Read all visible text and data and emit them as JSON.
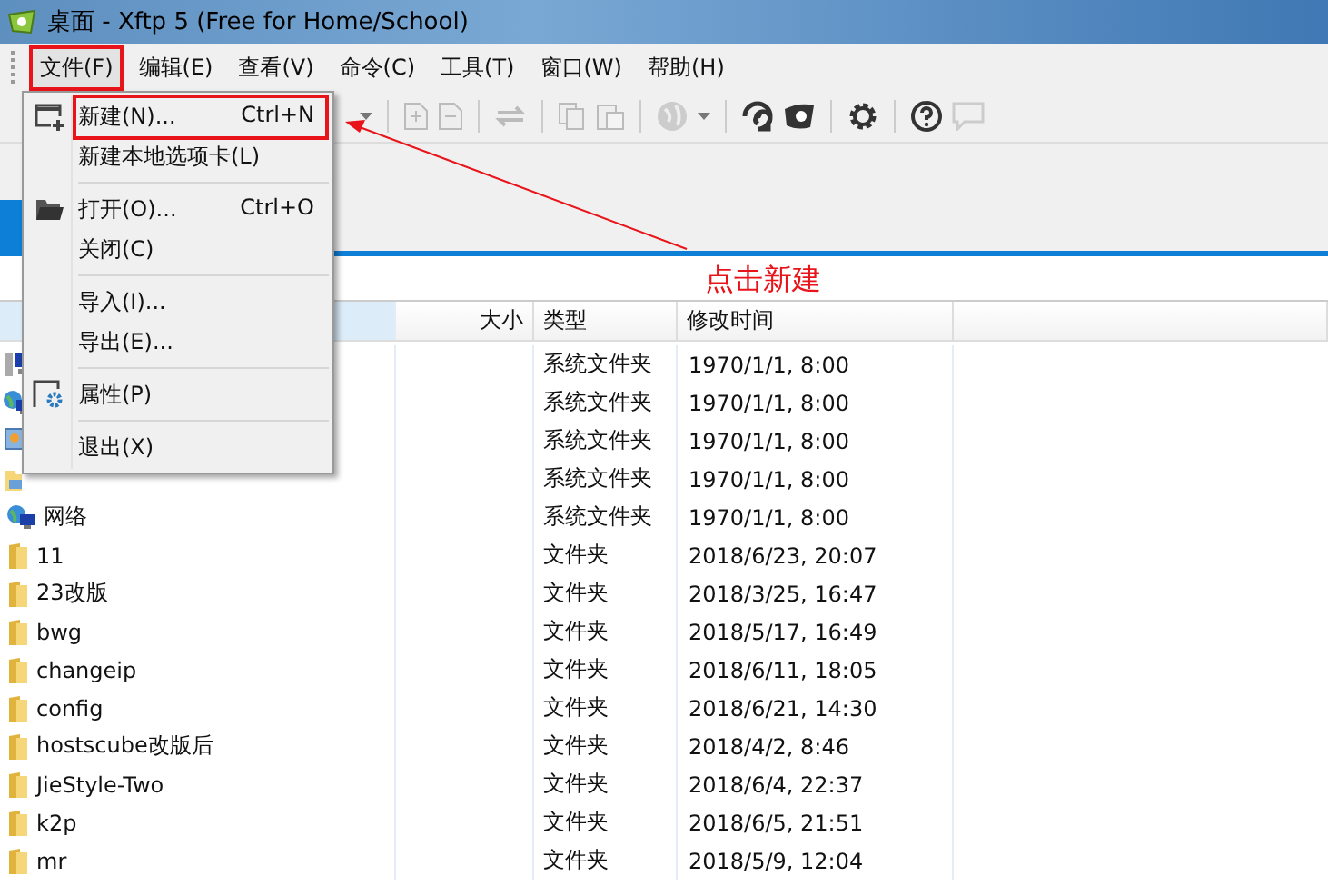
{
  "window": {
    "title": "桌面 - Xftp 5 (Free for Home/School)"
  },
  "menubar": [
    {
      "label": "文件(F)",
      "selected": true,
      "annotated": true
    },
    {
      "label": "编辑(E)",
      "selected": false,
      "annotated": false
    },
    {
      "label": "查看(V)",
      "selected": false,
      "annotated": false
    },
    {
      "label": "命令(C)",
      "selected": false,
      "annotated": false
    },
    {
      "label": "工具(T)",
      "selected": false,
      "annotated": false
    },
    {
      "label": "窗口(W)",
      "selected": false,
      "annotated": false
    },
    {
      "label": "帮助(H)",
      "selected": false,
      "annotated": false
    }
  ],
  "file_menu": [
    {
      "kind": "window",
      "label": "新建(N)...",
      "shortcut": "Ctrl+N",
      "annotated": true
    },
    {
      "kind": "plain",
      "label": "新建本地选项卡(L)",
      "annotated": false
    },
    {
      "kind": "separator"
    },
    {
      "kind": "folder",
      "label": "打开(O)...",
      "shortcut": "Ctrl+O",
      "annotated": false
    },
    {
      "kind": "plain",
      "label": "关闭(C)",
      "annotated": false
    },
    {
      "kind": "separator"
    },
    {
      "kind": "plain",
      "label": "导入(I)...",
      "annotated": false
    },
    {
      "kind": "plain",
      "label": "导出(E)...",
      "annotated": false
    },
    {
      "kind": "separator"
    },
    {
      "kind": "settings",
      "label": "属性(P)",
      "annotated": false
    },
    {
      "kind": "separator"
    },
    {
      "kind": "plain",
      "label": "退出(X)",
      "annotated": false
    }
  ],
  "annotation": {
    "text": "点击新建"
  },
  "table": {
    "columns": [
      {
        "label": "大小"
      },
      {
        "label": "类型"
      },
      {
        "label": "修改时间"
      }
    ],
    "rows": [
      {
        "kind": "computer",
        "type": "系统文件夹",
        "modified": "1970/1/1, 8:00"
      },
      {
        "kind": "network",
        "type": "系统文件夹",
        "modified": "1970/1/1, 8:00"
      },
      {
        "kind": "panel",
        "type": "系统文件夹",
        "modified": "1970/1/1, 8:00"
      },
      {
        "kind": "library",
        "type": "系统文件夹",
        "modified": "1970/1/1, 8:00"
      },
      {
        "kind": "network",
        "name": "网络",
        "type": "系统文件夹",
        "modified": "1970/1/1, 8:00"
      },
      {
        "kind": "folder",
        "name": "11",
        "type": "文件夹",
        "modified": "2018/6/23, 20:07"
      },
      {
        "kind": "folder",
        "name": "23改版",
        "type": "文件夹",
        "modified": "2018/3/25, 16:47"
      },
      {
        "kind": "folder",
        "name": "bwg",
        "type": "文件夹",
        "modified": "2018/5/17, 16:49"
      },
      {
        "kind": "folder",
        "name": "changeip",
        "type": "文件夹",
        "modified": "2018/6/11, 18:05"
      },
      {
        "kind": "folder",
        "name": "config",
        "type": "文件夹",
        "modified": "2018/6/21, 14:30"
      },
      {
        "kind": "folder",
        "name": "hostscube改版后",
        "type": "文件夹",
        "modified": "2018/4/2, 8:46"
      },
      {
        "kind": "folder",
        "name": "JieStyle-Two",
        "type": "文件夹",
        "modified": "2018/6/4, 22:37"
      },
      {
        "kind": "folder",
        "name": "k2p",
        "type": "文件夹",
        "modified": "2018/6/5, 21:51"
      },
      {
        "kind": "folder",
        "name": "mr",
        "type": "文件夹",
        "modified": "2018/5/9, 12:04"
      }
    ]
  }
}
